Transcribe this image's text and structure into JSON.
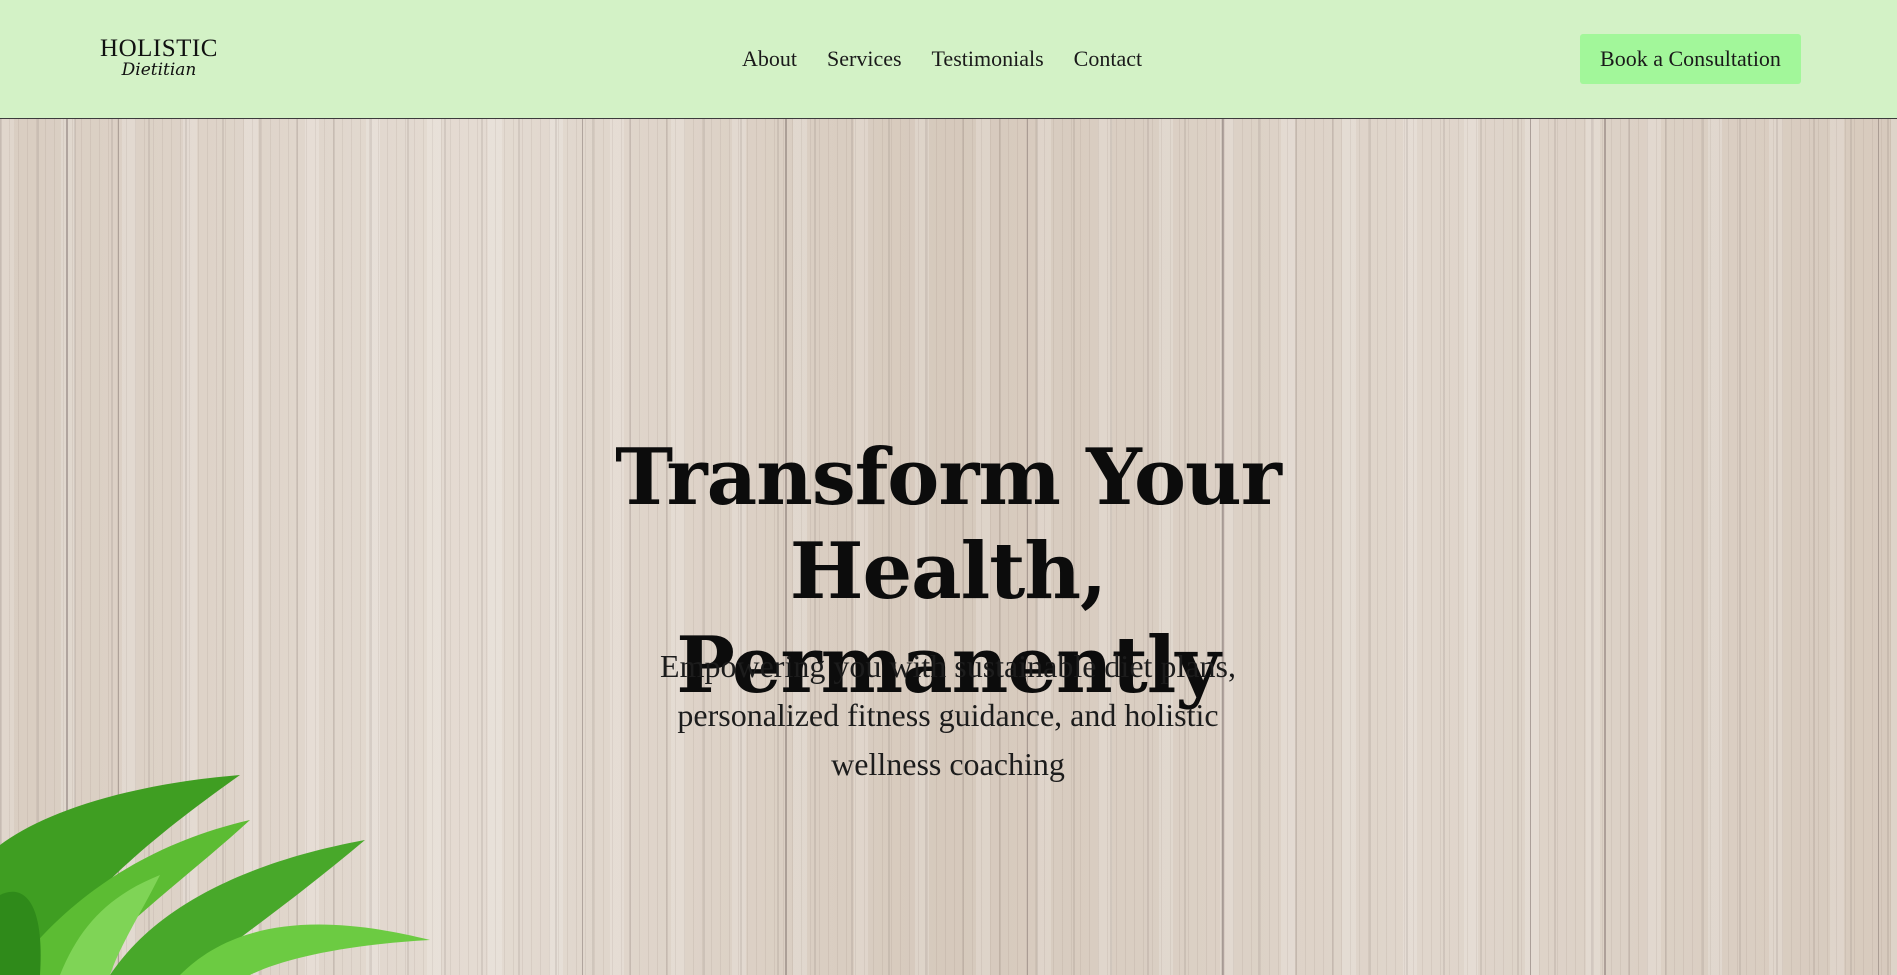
{
  "header": {
    "logo": {
      "main": "HOLISTIC",
      "sub": "Dietitian"
    },
    "nav": [
      {
        "label": "About"
      },
      {
        "label": "Services"
      },
      {
        "label": "Testimonials"
      },
      {
        "label": "Contact"
      }
    ],
    "cta_label": "Book a Consultation"
  },
  "hero": {
    "title_line1": "Transform Your Health,",
    "title_line2": "Permanently",
    "subtitle_line1": "Empowering you with sustainable diet plans,",
    "subtitle_line2": "personalized fitness guidance, and holistic",
    "subtitle_line3": "wellness coaching"
  },
  "colors": {
    "header_bg": "#d3f2c6",
    "cta_bg": "#a2f79a",
    "text": "#0c0c0c",
    "leaf_green": "#4caf2a"
  }
}
